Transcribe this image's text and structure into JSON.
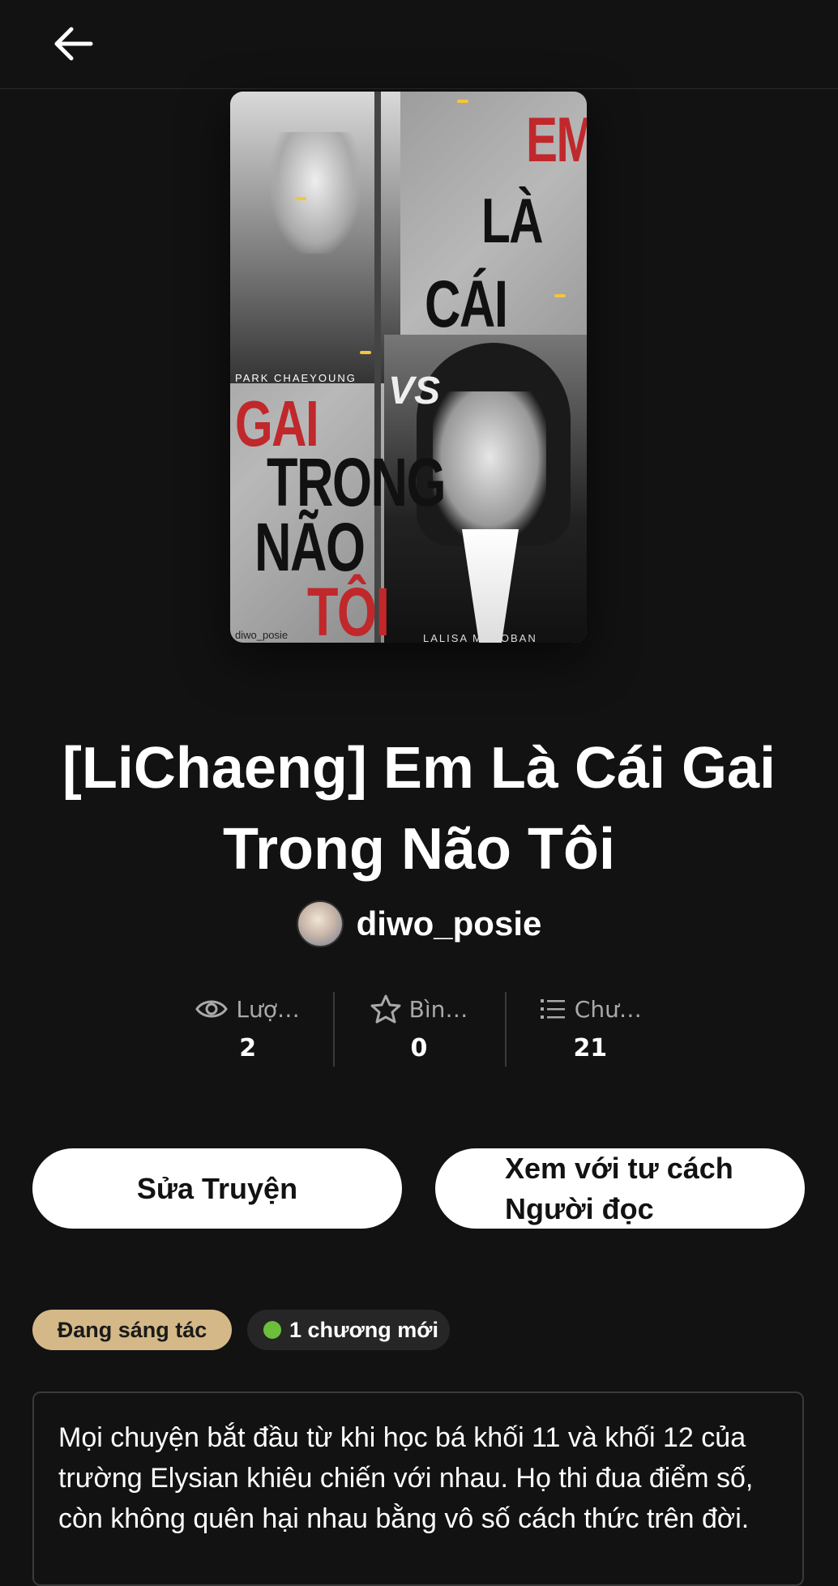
{
  "header": {
    "back_icon": "arrow-left-icon"
  },
  "cover": {
    "words": [
      "EM",
      "LÀ",
      "CÁI",
      "GAI",
      "TRONG",
      "NÃO",
      "TÔI"
    ],
    "vs": "VS",
    "name_a": "PARK CHAEYOUNG",
    "name_b": "LALISA MANOBAN",
    "credit": "diwo_posie",
    "accent_color": "#c0282b"
  },
  "story": {
    "title": "[LiChaeng] Em Là Cái Gai Trong Não Tôi",
    "author": "diwo_posie"
  },
  "stats": [
    {
      "icon": "eye-icon",
      "label": "Lượ…",
      "value": "2"
    },
    {
      "icon": "star-icon",
      "label": "Bìn…",
      "value": "0"
    },
    {
      "icon": "list-icon",
      "label": "Chư…",
      "value": "21"
    }
  ],
  "actions": {
    "edit_label": "Sửa Truyện",
    "reader_label_line1": "Xem với tư cách",
    "reader_label_line2": "Người đọc"
  },
  "tags": {
    "status": "Đang sáng tác",
    "new_chapters": "1 chương mới",
    "status_color": "#d4b887",
    "new_dot_color": "#6bbf3a"
  },
  "description": "Mọi chuyện bắt đầu từ khi học bá khối 11 và khối 12 của trường Elysian khiêu chiến với nhau. Họ thi đua điểm số, còn không quên hại nhau bằng vô số cách thức trên đời."
}
